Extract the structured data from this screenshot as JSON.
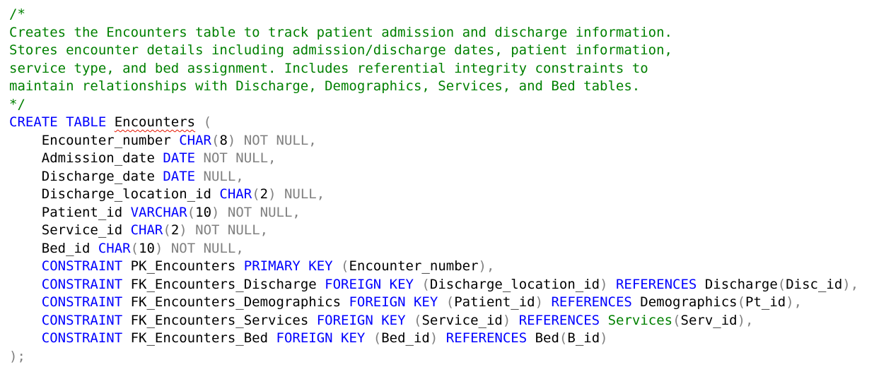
{
  "colors": {
    "comment": "#008000",
    "keyword": "#0000ff",
    "null_keyword": "#808080",
    "punctuation": "#808080",
    "identifier": "#000000",
    "builtin_function": "#008000",
    "error_squiggle": "#e51400"
  },
  "lines": [
    [
      {
        "t": "/*",
        "k": "comment"
      }
    ],
    [
      {
        "t": "Creates the Encounters table to track patient admission and discharge information.",
        "k": "comment"
      }
    ],
    [
      {
        "t": "Stores encounter details including admission/discharge dates, patient information,",
        "k": "comment"
      }
    ],
    [
      {
        "t": "service type, and bed assignment. Includes referential integrity constraints to",
        "k": "comment"
      }
    ],
    [
      {
        "t": "maintain relationships with Discharge, Demographics, Services, and Bed tables.",
        "k": "comment"
      }
    ],
    [
      {
        "t": "*/",
        "k": "comment"
      }
    ],
    [
      {
        "t": "CREATE TABLE",
        "k": "keyword"
      },
      {
        "t": " ",
        "k": "ident"
      },
      {
        "t": "Encounters",
        "k": "ident",
        "squiggle": true
      },
      {
        "t": " (",
        "k": "punct"
      }
    ],
    [
      {
        "t": "    Encounter_number ",
        "k": "ident"
      },
      {
        "t": "CHAR",
        "k": "keyword"
      },
      {
        "t": "(",
        "k": "punct"
      },
      {
        "t": "8",
        "k": "ident"
      },
      {
        "t": ")",
        "k": "punct"
      },
      {
        "t": " NOT NULL,",
        "k": "null"
      }
    ],
    [
      {
        "t": "    Admission_date ",
        "k": "ident"
      },
      {
        "t": "DATE",
        "k": "keyword"
      },
      {
        "t": " NOT NULL,",
        "k": "null"
      }
    ],
    [
      {
        "t": "    Discharge_date ",
        "k": "ident"
      },
      {
        "t": "DATE",
        "k": "keyword"
      },
      {
        "t": " NULL,",
        "k": "null"
      }
    ],
    [
      {
        "t": "    Discharge_location_id ",
        "k": "ident"
      },
      {
        "t": "CHAR",
        "k": "keyword"
      },
      {
        "t": "(",
        "k": "punct"
      },
      {
        "t": "2",
        "k": "ident"
      },
      {
        "t": ")",
        "k": "punct"
      },
      {
        "t": " NULL,",
        "k": "null"
      }
    ],
    [
      {
        "t": "    Patient_id ",
        "k": "ident"
      },
      {
        "t": "VARCHAR",
        "k": "keyword"
      },
      {
        "t": "(",
        "k": "punct"
      },
      {
        "t": "10",
        "k": "ident"
      },
      {
        "t": ")",
        "k": "punct"
      },
      {
        "t": " NOT NULL,",
        "k": "null"
      }
    ],
    [
      {
        "t": "    Service_id ",
        "k": "ident"
      },
      {
        "t": "CHAR",
        "k": "keyword"
      },
      {
        "t": "(",
        "k": "punct"
      },
      {
        "t": "2",
        "k": "ident"
      },
      {
        "t": ")",
        "k": "punct"
      },
      {
        "t": " NOT NULL,",
        "k": "null"
      }
    ],
    [
      {
        "t": "    Bed_id ",
        "k": "ident"
      },
      {
        "t": "CHAR",
        "k": "keyword"
      },
      {
        "t": "(",
        "k": "punct"
      },
      {
        "t": "10",
        "k": "ident"
      },
      {
        "t": ")",
        "k": "punct"
      },
      {
        "t": " NOT NULL,",
        "k": "null"
      }
    ],
    [
      {
        "t": "    ",
        "k": "ident"
      },
      {
        "t": "CONSTRAINT",
        "k": "keyword"
      },
      {
        "t": " PK_Encounters ",
        "k": "ident"
      },
      {
        "t": "PRIMARY KEY",
        "k": "keyword"
      },
      {
        "t": " (",
        "k": "punct"
      },
      {
        "t": "Encounter_number",
        "k": "ident"
      },
      {
        "t": "),",
        "k": "punct"
      }
    ],
    [
      {
        "t": "    ",
        "k": "ident"
      },
      {
        "t": "CONSTRAINT",
        "k": "keyword"
      },
      {
        "t": " FK_Encounters_Discharge ",
        "k": "ident"
      },
      {
        "t": "FOREIGN KEY",
        "k": "keyword"
      },
      {
        "t": " (",
        "k": "punct"
      },
      {
        "t": "Discharge_location_id",
        "k": "ident"
      },
      {
        "t": ") ",
        "k": "punct"
      },
      {
        "t": "REFERENCES",
        "k": "keyword"
      },
      {
        "t": " Discharge",
        "k": "ident"
      },
      {
        "t": "(",
        "k": "punct"
      },
      {
        "t": "Disc_id",
        "k": "ident"
      },
      {
        "t": "),",
        "k": "punct"
      }
    ],
    [
      {
        "t": "    ",
        "k": "ident"
      },
      {
        "t": "CONSTRAINT",
        "k": "keyword"
      },
      {
        "t": " FK_Encounters_Demographics ",
        "k": "ident"
      },
      {
        "t": "FOREIGN KEY",
        "k": "keyword"
      },
      {
        "t": " (",
        "k": "punct"
      },
      {
        "t": "Patient_id",
        "k": "ident"
      },
      {
        "t": ") ",
        "k": "punct"
      },
      {
        "t": "REFERENCES",
        "k": "keyword"
      },
      {
        "t": " Demographics",
        "k": "ident"
      },
      {
        "t": "(",
        "k": "punct"
      },
      {
        "t": "Pt_id",
        "k": "ident"
      },
      {
        "t": "),",
        "k": "punct"
      }
    ],
    [
      {
        "t": "    ",
        "k": "ident"
      },
      {
        "t": "CONSTRAINT",
        "k": "keyword"
      },
      {
        "t": " FK_Encounters_Services ",
        "k": "ident"
      },
      {
        "t": "FOREIGN KEY",
        "k": "keyword"
      },
      {
        "t": " (",
        "k": "punct"
      },
      {
        "t": "Service_id",
        "k": "ident"
      },
      {
        "t": ") ",
        "k": "punct"
      },
      {
        "t": "REFERENCES",
        "k": "keyword"
      },
      {
        "t": " ",
        "k": "ident"
      },
      {
        "t": "Services",
        "k": "func"
      },
      {
        "t": "(",
        "k": "punct"
      },
      {
        "t": "Serv_id",
        "k": "ident"
      },
      {
        "t": "),",
        "k": "punct"
      }
    ],
    [
      {
        "t": "    ",
        "k": "ident"
      },
      {
        "t": "CONSTRAINT",
        "k": "keyword"
      },
      {
        "t": " FK_Encounters_Bed ",
        "k": "ident"
      },
      {
        "t": "FOREIGN KEY",
        "k": "keyword"
      },
      {
        "t": " (",
        "k": "punct"
      },
      {
        "t": "Bed_id",
        "k": "ident"
      },
      {
        "t": ") ",
        "k": "punct"
      },
      {
        "t": "REFERENCES",
        "k": "keyword"
      },
      {
        "t": " Bed",
        "k": "ident"
      },
      {
        "t": "(",
        "k": "punct"
      },
      {
        "t": "B_id",
        "k": "ident"
      },
      {
        "t": ")",
        "k": "punct"
      }
    ],
    [
      {
        "t": ");",
        "k": "punct"
      }
    ]
  ]
}
